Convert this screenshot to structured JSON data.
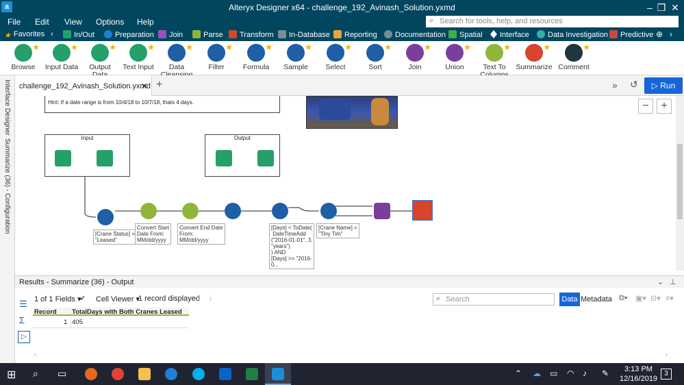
{
  "window": {
    "title": "Alteryx Designer x64 - challenge_192_Avinash_Solution.yxmd",
    "app_icon": "a"
  },
  "menu": [
    "File",
    "Edit",
    "View",
    "Options",
    "Help"
  ],
  "search": {
    "placeholder": "Search for tools, help, and resources"
  },
  "categories": [
    "Favorites",
    "In/Out",
    "Preparation",
    "Join",
    "Parse",
    "Transform",
    "In-Database",
    "Reporting",
    "Documentation",
    "Spatial",
    "Interface",
    "Data Investigation",
    "Predictive"
  ],
  "tools": [
    {
      "label": "Browse",
      "color": "#25a06a"
    },
    {
      "label": "Input Data",
      "color": "#25a06a"
    },
    {
      "label": "Output Data",
      "color": "#25a06a"
    },
    {
      "label": "Text Input",
      "color": "#25a06a"
    },
    {
      "label": "Data\nCleansing",
      "color": "#1e5fa6"
    },
    {
      "label": "Filter",
      "color": "#1e5fa6"
    },
    {
      "label": "Formula",
      "color": "#1e5fa6"
    },
    {
      "label": "Sample",
      "color": "#1e5fa6"
    },
    {
      "label": "Select",
      "color": "#1e5fa6"
    },
    {
      "label": "Sort",
      "color": "#1e5fa6"
    },
    {
      "label": "Join",
      "color": "#7a3f9d"
    },
    {
      "label": "Union",
      "color": "#7a3f9d"
    },
    {
      "label": "Text To\nColumns",
      "color": "#8fb63a"
    },
    {
      "label": "Summarize",
      "color": "#d6452c"
    },
    {
      "label": "Comment",
      "color": "#1f3540"
    }
  ],
  "sidebar": {
    "tab1": "Interface Designer",
    "tab2": "Summarize (36) - Configuration"
  },
  "doc_tab": {
    "label": "challenge_192_Avinash_Solution.yxmd",
    "close": "✕",
    "add": "+"
  },
  "run": {
    "label": "Run"
  },
  "zoom": {
    "minus": "−",
    "plus": "+"
  },
  "canvas": {
    "hint": "Hint:  If a date range is from 10/4/18 to 10/7/18, thats 4 days.",
    "input_box_title": "Input",
    "output_box_title": "Output",
    "annot_filter1": "[Crane Status] =\n\"Leased\"",
    "annot_start": "Convert Start\nDate From:\nMM/dd/yyyy",
    "annot_end": "Convert End Date\nFrom:\nMM/dd/yyyy",
    "annot_days": "[Days] < ToDate(\n DateTimeAdd\n(\"2016-01-01\", 3,\n\"years\")\n) AND\n[Days] >= \"2016-\n0...",
    "annot_crane": "[Crane Name] =\n\"Tiny Tim\""
  },
  "results": {
    "title": "Results - Summarize (36) - Output",
    "fields": "1 of 1 Fields",
    "viewer": "Cell Viewer",
    "records": "1 record displayed",
    "search_placeholder": "Search",
    "data_tab": "Data",
    "metadata_tab": "Metadata",
    "columns": [
      "Record",
      "TotalDays with Both Cranes Leased"
    ],
    "rows": [
      [
        "1",
        "405"
      ]
    ]
  },
  "taskbar": {
    "time": "3:13 PM",
    "date": "12/16/2019",
    "notif": "3"
  }
}
